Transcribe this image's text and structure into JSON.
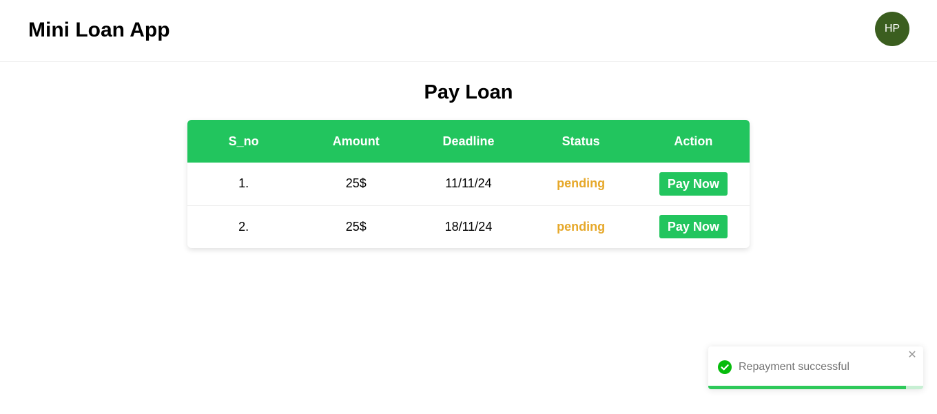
{
  "header": {
    "brand": "Mini Loan App",
    "avatar_initials": "HP"
  },
  "main": {
    "title": "Pay Loan",
    "table": {
      "columns": [
        "S_no",
        "Amount",
        "Deadline",
        "Status",
        "Action"
      ],
      "rows": [
        {
          "s_no": "1.",
          "amount": "25$",
          "deadline": "11/11/24",
          "status": "pending",
          "action": "Pay Now"
        },
        {
          "s_no": "2.",
          "amount": "25$",
          "deadline": "18/11/24",
          "status": "pending",
          "action": "Pay Now"
        }
      ]
    }
  },
  "toast": {
    "message": "Repayment successful",
    "icon": "check-circle-icon",
    "close_icon": "close-icon",
    "progress_fraction": 0.92
  },
  "colors": {
    "accent": "#22c55e",
    "avatar_bg": "#3b5e1f",
    "status_pending": "#e6a82a",
    "toast_success": "#07bc0c"
  }
}
